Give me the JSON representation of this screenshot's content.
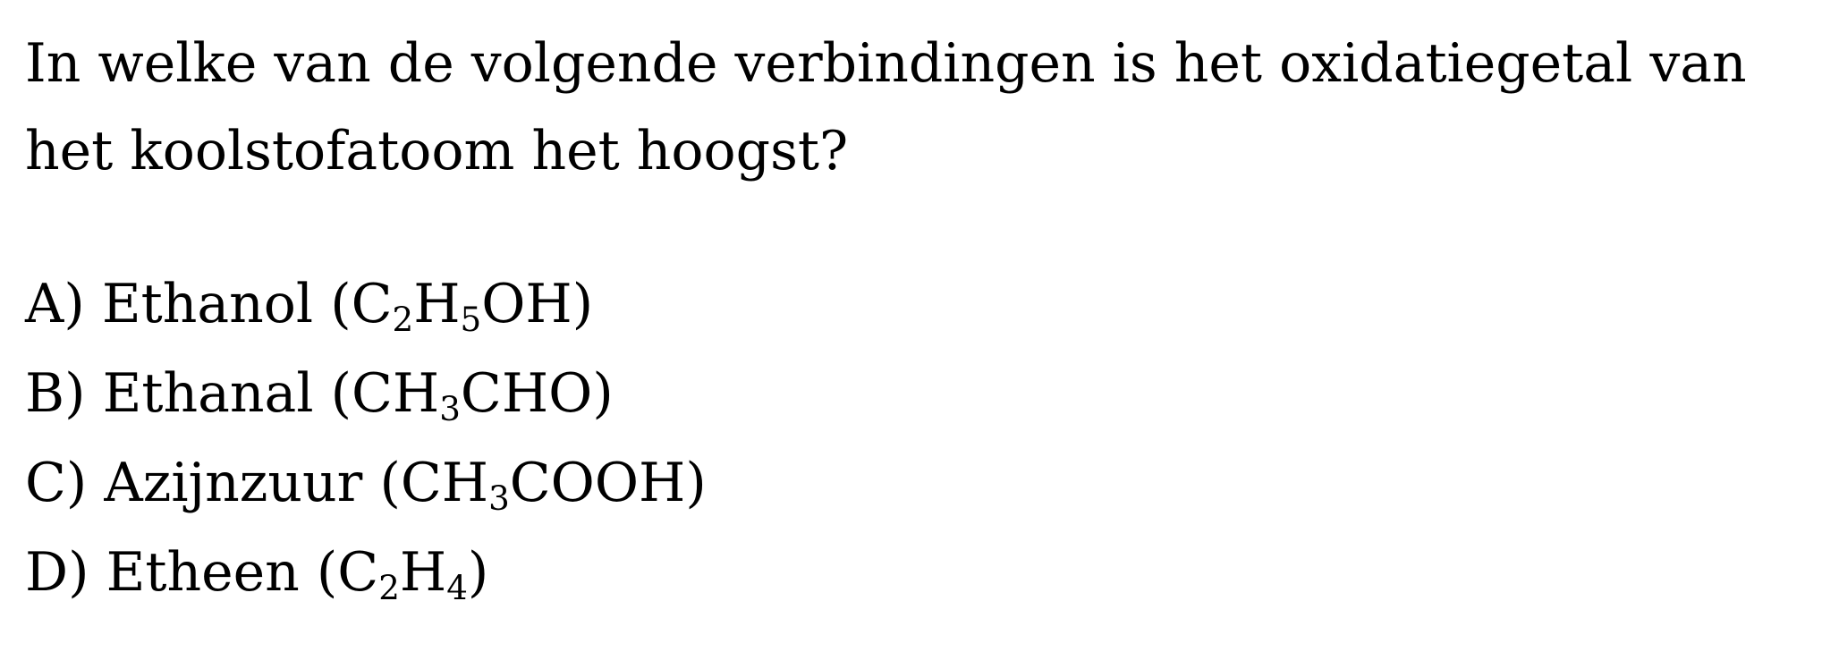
{
  "question": {
    "text": "In welke van de volgende verbindingen is het oxidatiegetal van het koolstofatoom het hoogst?"
  },
  "options": [
    {
      "letter": "A)",
      "name": "Ethanol",
      "formula_parts": [
        {
          "text": "(C",
          "sub": false
        },
        {
          "text": "2",
          "sub": true
        },
        {
          "text": "H",
          "sub": false
        },
        {
          "text": "5",
          "sub": true
        },
        {
          "text": "OH)",
          "sub": false
        }
      ]
    },
    {
      "letter": "B)",
      "name": "Ethanal",
      "formula_parts": [
        {
          "text": "(CH",
          "sub": false
        },
        {
          "text": "3",
          "sub": true
        },
        {
          "text": "CHO)",
          "sub": false
        }
      ]
    },
    {
      "letter": "C)",
      "name": "Azijnzuur",
      "formula_parts": [
        {
          "text": "(CH",
          "sub": false
        },
        {
          "text": "3",
          "sub": true
        },
        {
          "text": "COOH)",
          "sub": false
        }
      ]
    },
    {
      "letter": "D)",
      "name": "Etheen",
      "formula_parts": [
        {
          "text": "(C",
          "sub": false
        },
        {
          "text": "2",
          "sub": true
        },
        {
          "text": "H",
          "sub": false
        },
        {
          "text": "4",
          "sub": true
        },
        {
          "text": ")",
          "sub": false
        }
      ]
    }
  ]
}
